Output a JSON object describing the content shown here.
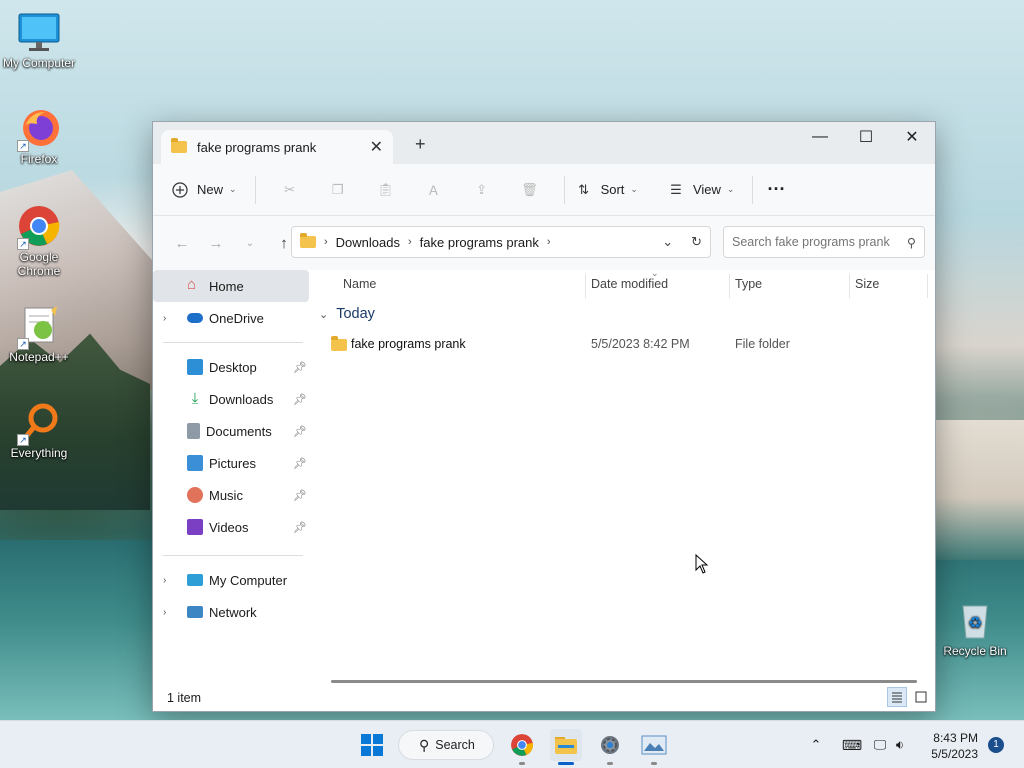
{
  "desktop": {
    "icons": [
      {
        "label": "My Computer"
      },
      {
        "label": "Firefox"
      },
      {
        "label": "Google Chrome"
      },
      {
        "label": "Notepad++"
      },
      {
        "label": "Everything"
      },
      {
        "label": "Recycle Bin"
      }
    ]
  },
  "window": {
    "tab_title": "fake programs prank",
    "new_tab_symbol": "+",
    "controls": {
      "minimize": "—",
      "maximize": "☐",
      "close": "✕"
    },
    "toolbar": {
      "new_label": "New",
      "sort_label": "Sort",
      "view_label": "View",
      "more_label": "···"
    },
    "address": {
      "crumbs": [
        "Downloads",
        "fake programs prank"
      ]
    },
    "search": {
      "placeholder": "Search fake programs prank"
    },
    "nav": {
      "home": "Home",
      "onedrive": "OneDrive",
      "quick": [
        "Desktop",
        "Downloads",
        "Documents",
        "Pictures",
        "Music",
        "Videos"
      ],
      "my_computer": "My Computer",
      "network": "Network"
    },
    "columns": {
      "name": "Name",
      "date": "Date modified",
      "type": "Type",
      "size": "Size"
    },
    "group_label": "Today",
    "files": [
      {
        "name": "fake programs prank",
        "date": "5/5/2023 8:42 PM",
        "type": "File folder"
      }
    ],
    "status": "1 item"
  },
  "taskbar": {
    "search_label": "Search",
    "time": "8:43 PM",
    "date": "5/5/2023",
    "notification_count": "1"
  },
  "colors": {
    "accent": "#0a60c8",
    "folder": "#f3c34b"
  }
}
